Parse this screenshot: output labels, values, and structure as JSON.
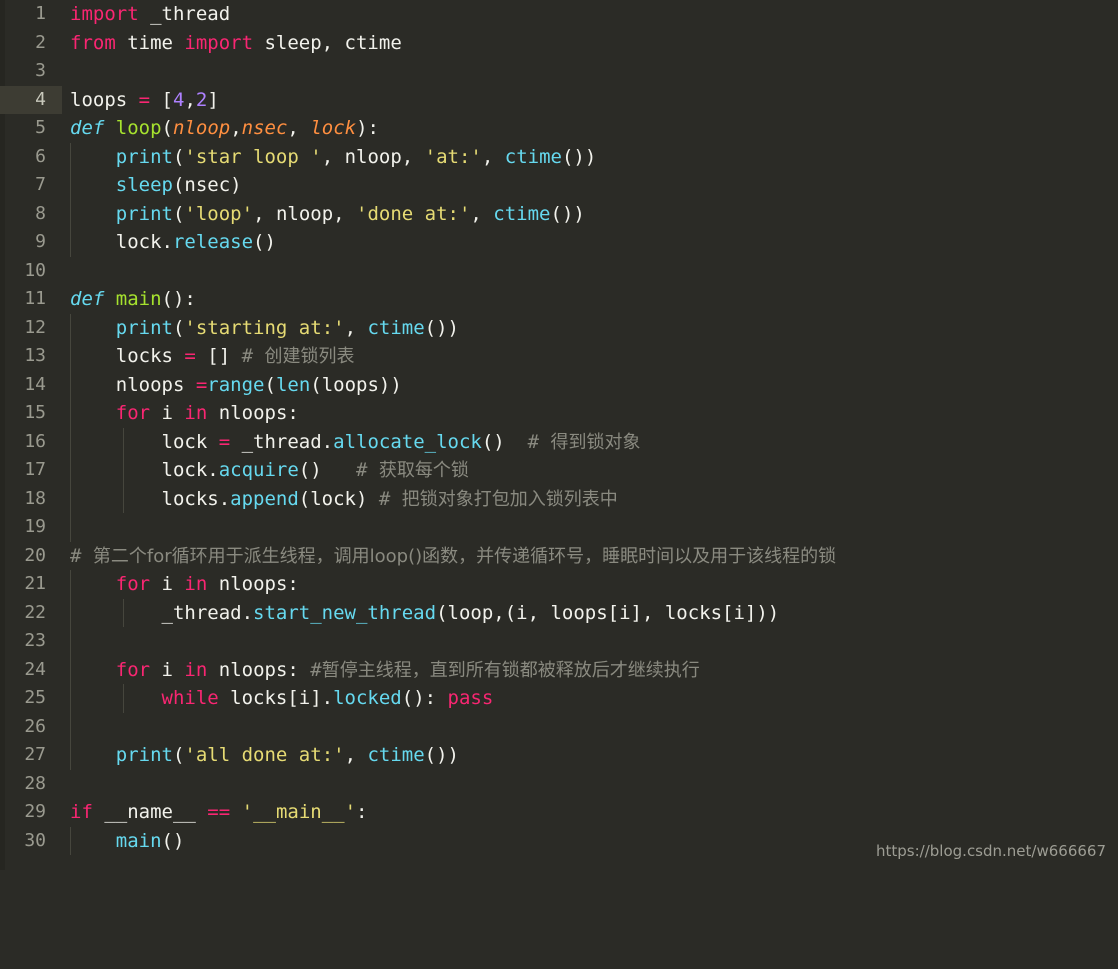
{
  "editor": {
    "language": "python",
    "theme": "monokai-dark",
    "background_color": "#2b2b26",
    "current_line": 4,
    "total_lines": 30
  },
  "colors": {
    "background": "#2b2b26",
    "current_line_gutter": "#3d3c33",
    "line_number": "#9a9a8f",
    "plain_text": "#f2f2ec",
    "keyword": "#f92672",
    "def_keyword": "#66d9ef",
    "function_name": "#a6e22e",
    "builtin": "#66d9ef",
    "string": "#e6db74",
    "number": "#ae81ff",
    "comment": "#8a8a80",
    "parameter": "#ff8f40"
  },
  "gutter": {
    "line_numbers": [
      "1",
      "2",
      "3",
      "4",
      "5",
      "6",
      "7",
      "8",
      "9",
      "10",
      "11",
      "12",
      "13",
      "14",
      "15",
      "16",
      "17",
      "18",
      "19",
      "20",
      "21",
      "22",
      "23",
      "24",
      "25",
      "26",
      "27",
      "28",
      "29",
      "30"
    ]
  },
  "code": {
    "lines": [
      {
        "n": "1",
        "indent": 0,
        "text": "import _thread"
      },
      {
        "n": "2",
        "indent": 0,
        "text": "from time import sleep, ctime"
      },
      {
        "n": "3",
        "indent": 0,
        "text": ""
      },
      {
        "n": "4",
        "indent": 0,
        "text": "loops = [4,2]"
      },
      {
        "n": "5",
        "indent": 0,
        "text": "def loop(nloop,nsec, lock):"
      },
      {
        "n": "6",
        "indent": 1,
        "text": "    print('star loop ', nloop, 'at:', ctime())"
      },
      {
        "n": "7",
        "indent": 1,
        "text": "    sleep(nsec)"
      },
      {
        "n": "8",
        "indent": 1,
        "text": "    print('loop', nloop, 'done at:', ctime())"
      },
      {
        "n": "9",
        "indent": 1,
        "text": "    lock.release()"
      },
      {
        "n": "10",
        "indent": 0,
        "text": ""
      },
      {
        "n": "11",
        "indent": 0,
        "text": "def main():"
      },
      {
        "n": "12",
        "indent": 1,
        "text": "    print('starting at:', ctime())"
      },
      {
        "n": "13",
        "indent": 1,
        "text": "    locks = [] # 创建锁列表"
      },
      {
        "n": "14",
        "indent": 1,
        "text": "    nloops =range(len(loops))"
      },
      {
        "n": "15",
        "indent": 1,
        "text": "    for i in nloops:"
      },
      {
        "n": "16",
        "indent": 2,
        "text": "        lock = _thread.allocate_lock()  # 得到锁对象"
      },
      {
        "n": "17",
        "indent": 2,
        "text": "        lock.acquire()   # 获取每个锁"
      },
      {
        "n": "18",
        "indent": 2,
        "text": "        locks.append(lock) # 把锁对象打包加入锁列表中"
      },
      {
        "n": "19",
        "indent": 1,
        "text": ""
      },
      {
        "n": "20",
        "indent": 0,
        "text": "# 第二个for循环用于派生线程，调用loop()函数，并传递循环号，睡眠时间以及用于该线程的锁"
      },
      {
        "n": "21",
        "indent": 1,
        "text": "    for i in nloops:"
      },
      {
        "n": "22",
        "indent": 2,
        "text": "        _thread.start_new_thread(loop,(i, loops[i], locks[i]))"
      },
      {
        "n": "23",
        "indent": 1,
        "text": ""
      },
      {
        "n": "24",
        "indent": 1,
        "text": "    for i in nloops: #暂停主线程，直到所有锁都被释放后才继续执行"
      },
      {
        "n": "25",
        "indent": 2,
        "text": "        while locks[i].locked(): pass"
      },
      {
        "n": "26",
        "indent": 1,
        "text": ""
      },
      {
        "n": "27",
        "indent": 1,
        "text": "    print('all done at:', ctime())"
      },
      {
        "n": "28",
        "indent": 0,
        "text": ""
      },
      {
        "n": "29",
        "indent": 0,
        "text": "if __name__ == '__main__':"
      },
      {
        "n": "30",
        "indent": 1,
        "text": "    main()"
      }
    ]
  },
  "watermark": {
    "text": "https://blog.csdn.net/w666667"
  }
}
